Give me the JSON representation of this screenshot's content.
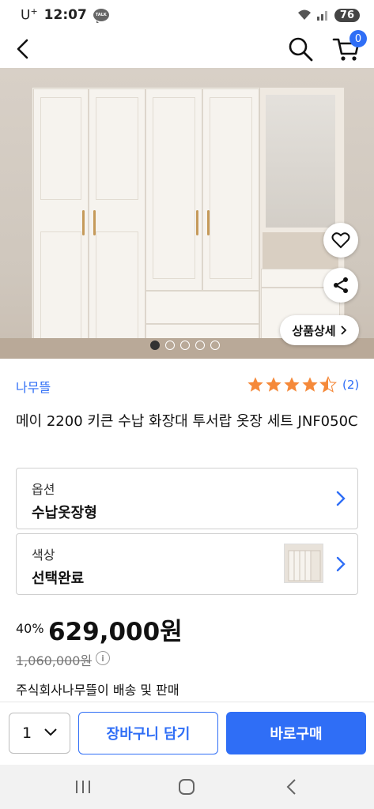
{
  "status_bar": {
    "carrier": "U",
    "carrier_sup": "+",
    "time": "12:07",
    "talk_label": "TALK",
    "battery": "76"
  },
  "app_bar": {
    "cart_count": "0",
    "icons": [
      "back-arrow-icon",
      "search-icon",
      "cart-icon"
    ]
  },
  "gallery": {
    "detail_button_label": "상품상세",
    "image_count": 5,
    "active_index": 0
  },
  "product": {
    "brand": "나무뜰",
    "rating": 4.5,
    "review_count": "(2)",
    "title": "메이 2200 키큰 수납 화장대 투서랍 옷장 세트 JNF050C",
    "options": [
      {
        "label": "옵션",
        "value": "수납옷장형"
      },
      {
        "label": "색상",
        "value": "선택완료"
      }
    ],
    "discount": "40%",
    "price": "629,000원",
    "original_price": "1,060,000원",
    "seller_note": "주식회사나무뜰이 배송 및 판매"
  },
  "bottom_bar": {
    "quantity": "1",
    "add_to_cart": "장바구니 담기",
    "buy_now": "바로구매"
  },
  "colors": {
    "accent": "#2f6ef6",
    "star": "#f5893a"
  }
}
